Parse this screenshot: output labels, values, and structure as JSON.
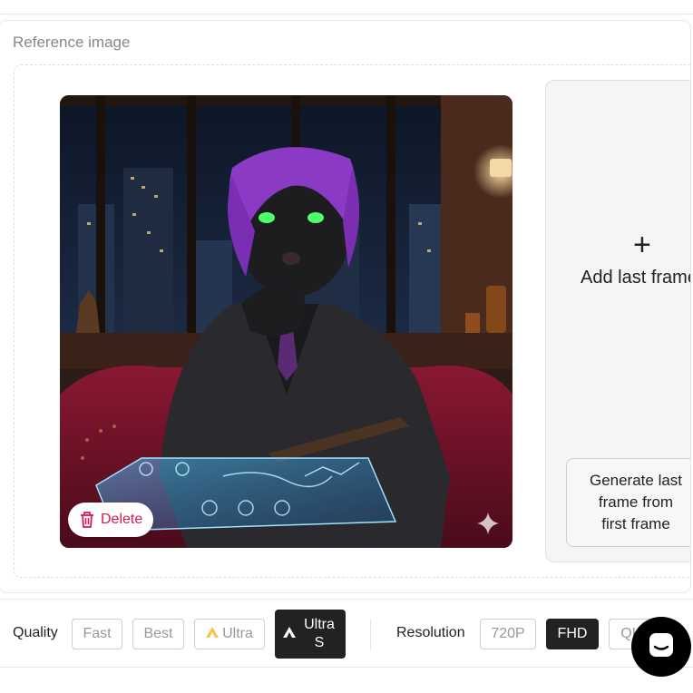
{
  "reference": {
    "title": "Reference image",
    "delete_label": "Delete"
  },
  "add_last_frame": {
    "plus": "+",
    "label": "Add last frame",
    "generate_line1": "Generate last",
    "generate_line2": "frame from",
    "generate_line3": "first frame"
  },
  "quality": {
    "label": "Quality",
    "options": [
      "Fast",
      "Best",
      "Ultra",
      "Ultra S"
    ],
    "selected": "Ultra S",
    "accent": "#f3c64a"
  },
  "resolution": {
    "label": "Resolution",
    "options": [
      "720P",
      "FHD",
      "QHD"
    ],
    "selected": "FHD"
  },
  "colors": {
    "delete": "#d81b4f",
    "active_chip": "#222222"
  },
  "icons": [
    "trash-icon",
    "sparkle-icon",
    "plus-icon",
    "ultra-icon",
    "chat-icon"
  ]
}
